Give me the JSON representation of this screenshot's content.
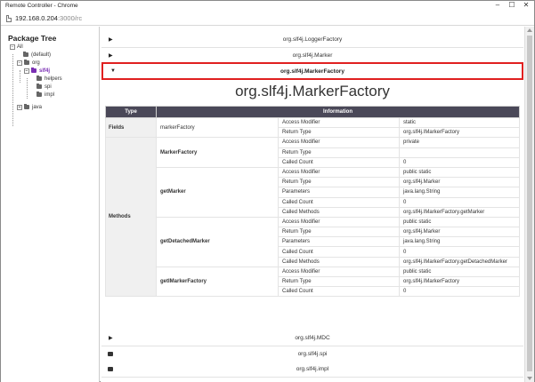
{
  "window": {
    "title": "Remote Controller - Chrome",
    "url_host": "192.168.0.204",
    "url_rest": ":3000/rc"
  },
  "sidebar": {
    "title": "Package Tree",
    "nodes": {
      "all": "All",
      "default": "(default)",
      "org": "org",
      "slf4j": "slf4j",
      "helpers": "helpers",
      "spi": "spi",
      "impl": "impl",
      "java": "java"
    }
  },
  "accordion": {
    "logger_factory": "org.slf4j.LoggerFactory",
    "marker": "org.slf4j.Marker",
    "marker_factory": "org.slf4j.MarkerFactory",
    "mdc": "org.slf4j.MDC",
    "spi": "org.slf4j.spi",
    "impl": "org.slf4j.impl"
  },
  "detail": {
    "class_title": "org.slf4j.MarkerFactory",
    "headers": {
      "type": "Type",
      "information": "Information"
    },
    "fields": {
      "type": "Fields",
      "name": "markerFactory",
      "rows": [
        {
          "key": "Access Modifier",
          "value": "static"
        },
        {
          "key": "Return Type",
          "value": "org.slf4j.IMarkerFactory"
        }
      ]
    },
    "methods": {
      "type": "Methods",
      "items": [
        {
          "name": "MarkerFactory",
          "rows": [
            {
              "key": "Access Modifier",
              "value": "private"
            },
            {
              "key": "Return Type",
              "value": ""
            },
            {
              "key": "Called Count",
              "value": "0"
            }
          ]
        },
        {
          "name": "getMarker",
          "rows": [
            {
              "key": "Access Modifier",
              "value": "public static"
            },
            {
              "key": "Return Type",
              "value": "org.slf4j.Marker"
            },
            {
              "key": "Parameters",
              "value": "java.lang.String"
            },
            {
              "key": "Called Count",
              "value": "0"
            },
            {
              "key": "Called Methods",
              "value": "org.slf4j.IMarkerFactory.getMarker"
            }
          ]
        },
        {
          "name": "getDetachedMarker",
          "rows": [
            {
              "key": "Access Modifier",
              "value": "public static"
            },
            {
              "key": "Return Type",
              "value": "org.slf4j.Marker"
            },
            {
              "key": "Parameters",
              "value": "java.lang.String"
            },
            {
              "key": "Called Count",
              "value": "0"
            },
            {
              "key": "Called Methods",
              "value": "org.slf4j.IMarkerFactory.getDetachedMarker"
            }
          ]
        },
        {
          "name": "getIMarkerFactory",
          "rows": [
            {
              "key": "Access Modifier",
              "value": "public static"
            },
            {
              "key": "Return Type",
              "value": "org.slf4j.IMarkerFactory"
            },
            {
              "key": "Called Count",
              "value": "0"
            }
          ]
        }
      ]
    }
  },
  "icons": {
    "minimize": "minimize-icon",
    "maximize": "maximize-icon",
    "close": "close-icon",
    "page": "page-icon",
    "collapse": "collapse-icon",
    "expand": "expand-icon",
    "folder": "folder-icon",
    "arrow_right": "arrow-right-icon",
    "arrow_down": "arrow-down-icon",
    "package": "package-icon"
  },
  "colors": {
    "active_node": "#7a2fb3",
    "table_header": "#4a4858",
    "open_border": "#e02020"
  }
}
